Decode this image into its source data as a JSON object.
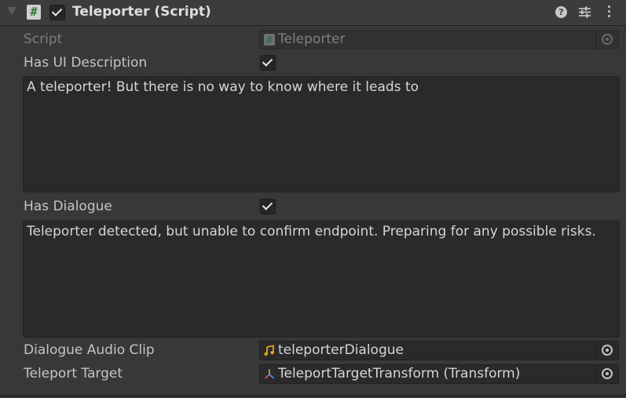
{
  "component": {
    "title": "Teleporter (Script)",
    "enabled": true,
    "help_icon": "help-icon",
    "presets_icon": "presets-icon",
    "menu_icon": "kebab-menu-icon"
  },
  "fields": {
    "script": {
      "label": "Script",
      "value": "Teleporter",
      "icon": "script-icon"
    },
    "has_ui_description": {
      "label": "Has UI Description",
      "checked": true
    },
    "ui_description_text": "A teleporter! But there is no way to know where it leads to",
    "has_dialogue": {
      "label": "Has Dialogue",
      "checked": true
    },
    "dialogue_text": "Teleporter detected, but unable to confirm endpoint. Preparing for any possible risks.",
    "dialogue_audio_clip": {
      "label": "Dialogue Audio Clip",
      "value": "teleporterDialogue",
      "icon": "audio-clip-icon"
    },
    "teleport_target": {
      "label": "Teleport Target",
      "value": "TeleportTargetTransform (Transform)",
      "icon": "transform-icon"
    }
  },
  "colors": {
    "background": "#383838",
    "field_background": "#2a2a2a",
    "script_icon": "#2c7b3c",
    "audio_icon": "#e3a41b"
  }
}
